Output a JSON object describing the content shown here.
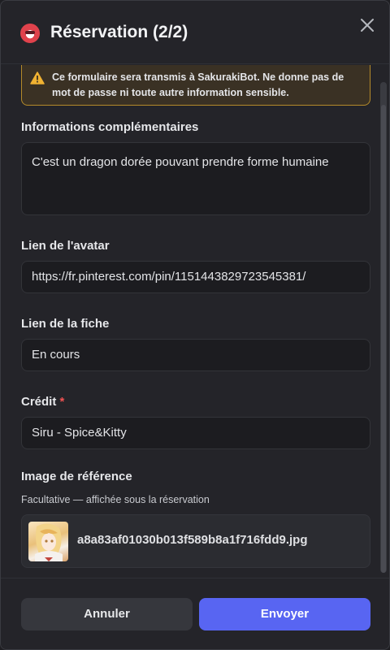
{
  "header": {
    "title": "Réservation (2/2)",
    "bot_avatar": "bot-avatar",
    "close_icon": "close-icon"
  },
  "warning": {
    "prefix": "Ce formulaire sera transmis à ",
    "bot_name": "SakurakiBot",
    "suffix": ". Ne donne pas de mot de passe ni toute autre information sensible.",
    "icon": "warning-icon",
    "color": "#b48a2a"
  },
  "fields": {
    "extra_info": {
      "label": "Informations complémentaires",
      "value": "C'est un dragon dorée pouvant prendre forme humaine"
    },
    "avatar_link": {
      "label": "Lien de l'avatar",
      "value": "https://fr.pinterest.com/pin/1151443829723545381/"
    },
    "sheet_link": {
      "label": "Lien de la fiche",
      "value": "En cours"
    },
    "credit": {
      "label": "Crédit",
      "required_mark": "*",
      "value": "Siru - Spice&Kitty"
    },
    "reference_image": {
      "label": "Image de référence",
      "sublabel": "Facultative — affichée sous la réservation",
      "filename": "a8a83af01030b013f589b8a1f716fdd9.jpg"
    }
  },
  "footer": {
    "cancel_label": "Annuler",
    "submit_label": "Envoyer",
    "accent": "#5865f2"
  }
}
